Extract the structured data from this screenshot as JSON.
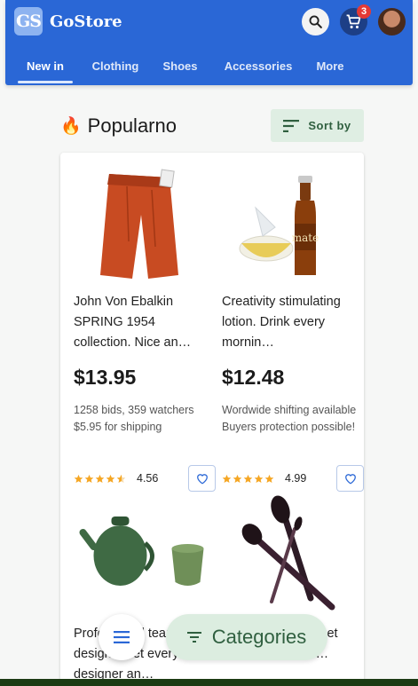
{
  "header": {
    "logo_text": "GS",
    "brand": "GoStore",
    "cart_count": "3",
    "tabs": [
      {
        "label": "New in"
      },
      {
        "label": "Clothing"
      },
      {
        "label": "Shoes"
      },
      {
        "label": "Accessories"
      },
      {
        "label": "More"
      }
    ],
    "active_tab": "New in"
  },
  "section": {
    "emoji": "🔥",
    "title": "Popularno",
    "sort_label": "Sort by"
  },
  "products": [
    {
      "name": "John Von Ebalkin SPRING 1954 collection. Nice an…",
      "price": "$13.95",
      "desc": "1258 bids, 359 watchers $5.95 for shipping",
      "rating": "4.56",
      "rating_value": 4.56,
      "image": "red-pants"
    },
    {
      "name": "Creativity stimulating lotion. Drink every mornin…",
      "price": "$12.48",
      "desc": "Wordwide shifting available Buyers protection possible!",
      "rating": "4.99",
      "rating_value": 4.99,
      "image": "mate-bottle"
    },
    {
      "name": "Professional teapot designer set every designer an…",
      "price": "",
      "desc": "",
      "rating": "",
      "image": "green-teapot"
    },
    {
      "name": "Makeup brushes set cosmetics brand…",
      "price": "",
      "desc": "",
      "rating": "",
      "image": "makeup-brushes"
    }
  ],
  "bottom": {
    "categories_label": "Categories"
  },
  "colors": {
    "primary": "#2a67d6",
    "accent_green": "#dcede0",
    "badge": "#e53935",
    "star": "#f5a623"
  }
}
